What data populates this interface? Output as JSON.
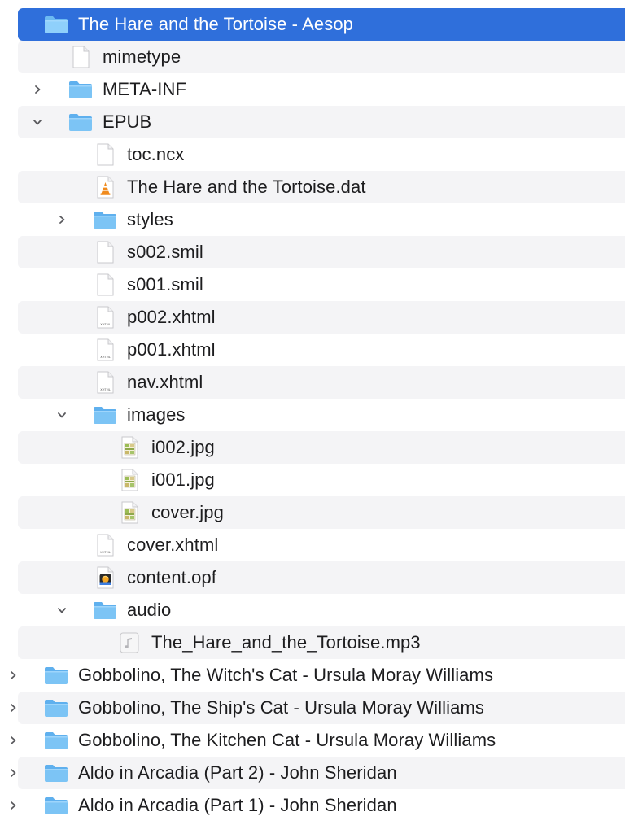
{
  "tree": [
    {
      "label": "The Hare and the Tortoise - Aesop",
      "level": 0,
      "kind": "folder",
      "expanded": true,
      "selected": true
    },
    {
      "label": "mimetype",
      "level": 1,
      "kind": "file"
    },
    {
      "label": "META-INF",
      "level": 1,
      "kind": "folder",
      "expanded": false
    },
    {
      "label": "EPUB",
      "level": 1,
      "kind": "folder",
      "expanded": true
    },
    {
      "label": "toc.ncx",
      "level": 2,
      "kind": "file"
    },
    {
      "label": "The Hare and the Tortoise.dat",
      "level": 2,
      "kind": "vlc"
    },
    {
      "label": "styles",
      "level": 2,
      "kind": "folder",
      "expanded": false
    },
    {
      "label": "s002.smil",
      "level": 2,
      "kind": "file"
    },
    {
      "label": "s001.smil",
      "level": 2,
      "kind": "file"
    },
    {
      "label": "p002.xhtml",
      "level": 2,
      "kind": "xhtml"
    },
    {
      "label": "p001.xhtml",
      "level": 2,
      "kind": "xhtml"
    },
    {
      "label": "nav.xhtml",
      "level": 2,
      "kind": "xhtml"
    },
    {
      "label": "images",
      "level": 2,
      "kind": "folder",
      "expanded": true
    },
    {
      "label": "i002.jpg",
      "level": 3,
      "kind": "image"
    },
    {
      "label": "i001.jpg",
      "level": 3,
      "kind": "image"
    },
    {
      "label": "cover.jpg",
      "level": 3,
      "kind": "image"
    },
    {
      "label": "cover.xhtml",
      "level": 2,
      "kind": "xhtml"
    },
    {
      "label": "content.opf",
      "level": 2,
      "kind": "opf"
    },
    {
      "label": "audio",
      "level": 2,
      "kind": "folder",
      "expanded": true
    },
    {
      "label": "The_Hare_and_the_Tortoise.mp3",
      "level": 3,
      "kind": "audio"
    },
    {
      "label": "Gobbolino, The Witch's Cat - Ursula Moray Williams",
      "level": 0,
      "kind": "folder",
      "expanded": false
    },
    {
      "label": "Gobbolino, The Ship's Cat - Ursula Moray Williams",
      "level": 0,
      "kind": "folder",
      "expanded": false
    },
    {
      "label": "Gobbolino, The Kitchen Cat - Ursula Moray Williams",
      "level": 0,
      "kind": "folder",
      "expanded": false
    },
    {
      "label": "Aldo in Arcadia (Part 2) - John Sheridan",
      "level": 0,
      "kind": "folder",
      "expanded": false
    },
    {
      "label": "Aldo in Arcadia (Part 1) - John Sheridan",
      "level": 0,
      "kind": "folder",
      "expanded": false
    }
  ],
  "icons": {
    "folder": "folder-icon",
    "file": "document-icon",
    "xhtml": "xhtml-document-icon",
    "vlc": "vlc-cone-icon",
    "image": "jpeg-image-icon",
    "opf": "opf-document-icon",
    "audio": "audio-file-icon",
    "xhtml_badge": "XHTML"
  },
  "colors": {
    "selection": "#2f6fdb",
    "stripe": "#f4f4f6",
    "folder_body": "#7cc4f5",
    "folder_tab": "#5fb0ee"
  }
}
